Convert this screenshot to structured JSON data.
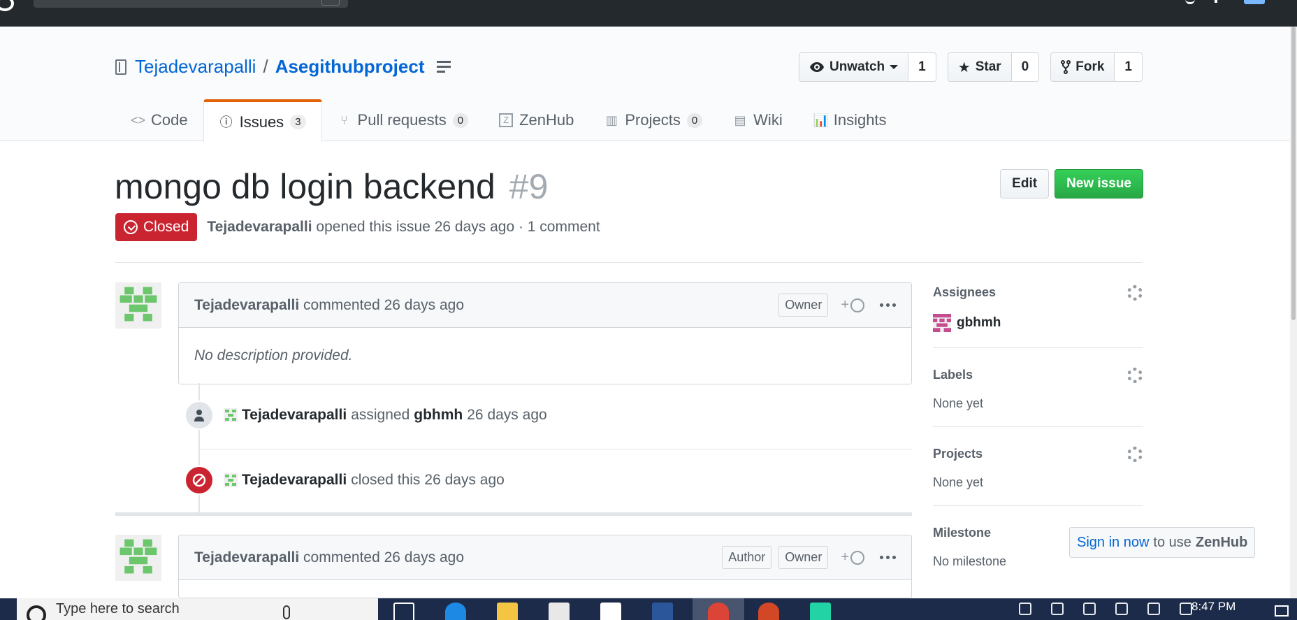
{
  "repo": {
    "owner": "Tejadevarapalli",
    "separator": "/",
    "name": "Asegithubproject"
  },
  "actions": {
    "watch_label": "Unwatch",
    "watch_count": "1",
    "star_label": "Star",
    "star_count": "0",
    "fork_label": "Fork",
    "fork_count": "1"
  },
  "nav": {
    "tabs": [
      {
        "label": "Code",
        "icon": "code-icon"
      },
      {
        "label": "Issues",
        "icon": "issue-opened-icon",
        "count": "3",
        "selected": true
      },
      {
        "label": "Pull requests",
        "icon": "git-pull-request-icon",
        "count": "0"
      },
      {
        "label": "ZenHub",
        "icon": "zenhub-icon"
      },
      {
        "label": "Projects",
        "icon": "project-icon",
        "count": "0"
      },
      {
        "label": "Wiki",
        "icon": "book-icon"
      },
      {
        "label": "Insights",
        "icon": "graph-icon"
      }
    ]
  },
  "issue": {
    "title": "mongo db login backend",
    "number": "#9",
    "state": "Closed",
    "author": "Tejadevarapalli",
    "opened_text": "opened this issue 26 days ago · 1 comment",
    "edit_label": "Edit",
    "new_issue_label": "New issue"
  },
  "comments": [
    {
      "author": "Tejadevarapalli",
      "action": "commented 26 days ago",
      "badges": [
        "Owner"
      ],
      "body": "No description provided."
    },
    {
      "author": "Tejadevarapalli",
      "action": "commented 26 days ago",
      "badges": [
        "Author",
        "Owner"
      ]
    }
  ],
  "reaction_plus": "+",
  "events": [
    {
      "actor": "Tejadevarapalli",
      "verb": "assigned",
      "target": "gbhmh",
      "time": "26 days ago"
    },
    {
      "actor": "Tejadevarapalli",
      "verb": "closed this",
      "time": "26 days ago"
    }
  ],
  "sidebar": {
    "assignees": {
      "title": "Assignees",
      "value": "gbhmh"
    },
    "labels": {
      "title": "Labels",
      "value": "None yet"
    },
    "projects": {
      "title": "Projects",
      "value": "None yet"
    },
    "milestone": {
      "title": "Milestone",
      "value": "No milestone"
    }
  },
  "zenhub_tip": {
    "link": "Sign in now",
    "middle": "to use",
    "brand": "ZenHub"
  },
  "taskbar": {
    "search_placeholder": "Type here to search",
    "time": "8:47 PM"
  },
  "colors": {
    "accent": "#0366d6",
    "closed": "#cb2431",
    "success": "#28a745",
    "tab_underline": "#e36209",
    "identicon_green": "#6cc66c",
    "identicon_pink": "#c54c8e"
  }
}
